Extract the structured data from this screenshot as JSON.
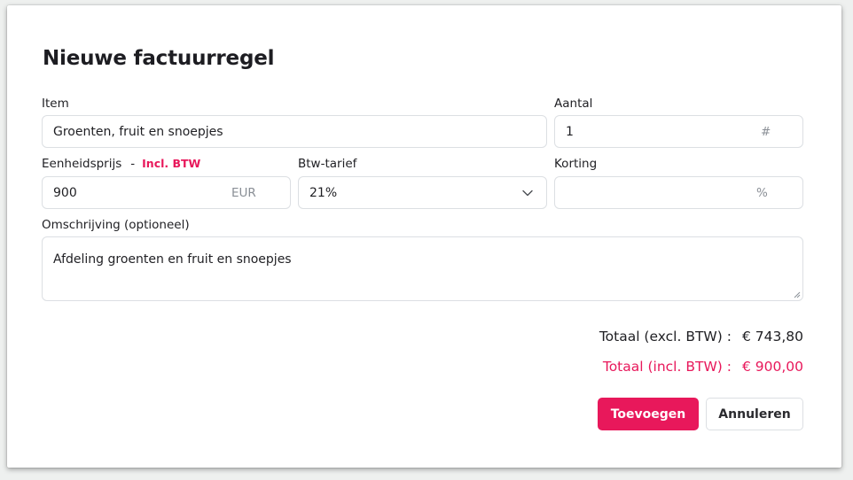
{
  "dialog": {
    "title": "Nieuwe factuurregel"
  },
  "item": {
    "label": "Item",
    "value": "Groenten, fruit en snoepjes"
  },
  "quantity": {
    "label": "Aantal",
    "value": "1",
    "suffix": "#"
  },
  "unit_price": {
    "label": "Eenheidsprijs",
    "separator": "-",
    "mode": "Incl. BTW",
    "value": "900",
    "currency": "EUR"
  },
  "vat_rate": {
    "label": "Btw-tarief",
    "value": "21%",
    "icon": "chevron-down-icon"
  },
  "discount": {
    "label": "Korting",
    "value": "",
    "suffix": "%"
  },
  "description": {
    "label": "Omschrijving (optioneel)",
    "value": "Afdeling groenten en fruit en snoepjes"
  },
  "totals": {
    "excl_label": "Totaal (excl. BTW) :",
    "excl_amount": "€ 743,80",
    "incl_label": "Totaal (incl. BTW) :",
    "incl_amount": "€ 900,00"
  },
  "actions": {
    "add_label": "Toevoegen",
    "cancel_label": "Annuleren"
  },
  "colors": {
    "accent": "#e8185b",
    "border": "#dcdfe3",
    "text": "#1f1f23"
  }
}
